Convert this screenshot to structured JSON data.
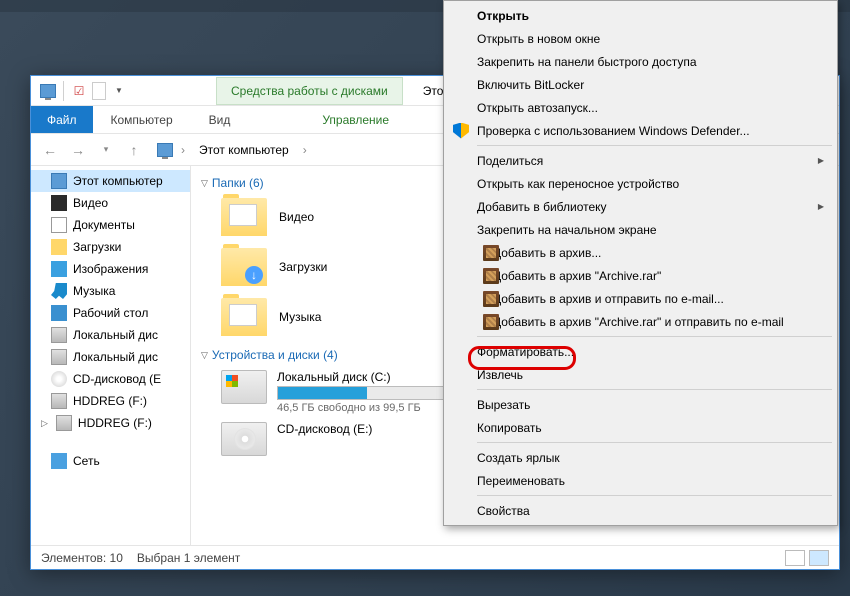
{
  "window": {
    "ribbon_context": "Средства работы с дисками",
    "title": "Этот к",
    "menu": {
      "file": "Файл",
      "computer": "Компьютер",
      "view": "Вид",
      "manage": "Управление"
    },
    "breadcrumb": "Этот компьютер"
  },
  "sidebar": {
    "items": [
      {
        "label": "Этот компьютер",
        "icon": "pc"
      },
      {
        "label": "Видео",
        "icon": "vid"
      },
      {
        "label": "Документы",
        "icon": "doc"
      },
      {
        "label": "Загрузки",
        "icon": "dl"
      },
      {
        "label": "Изображения",
        "icon": "img"
      },
      {
        "label": "Музыка",
        "icon": "mus"
      },
      {
        "label": "Рабочий стол",
        "icon": "desk"
      },
      {
        "label": "Локальный дис",
        "icon": "hdd"
      },
      {
        "label": "Локальный дис",
        "icon": "hdd"
      },
      {
        "label": "CD-дисковод (E",
        "icon": "cd"
      },
      {
        "label": "HDDREG (F:)",
        "icon": "hdd"
      },
      {
        "label": "HDDREG (F:)",
        "icon": "hdd"
      },
      {
        "label": "Сеть",
        "icon": "net"
      }
    ]
  },
  "content": {
    "folders_header": "Папки (6)",
    "folders": [
      {
        "label": "Видео"
      },
      {
        "label": "Загрузки"
      },
      {
        "label": "Музыка"
      }
    ],
    "drives_header": "Устройства и диски (4)",
    "drives": [
      {
        "label": "Локальный диск (C:)",
        "free_text": "46,5 ГБ свободно из 99,5 ГБ",
        "fill_pct": 53,
        "type": "win"
      },
      {
        "label": "CD-дисковод (E:)",
        "free_text": "",
        "fill_pct": 0,
        "type": "cd"
      }
    ]
  },
  "status": {
    "count": "Элементов: 10",
    "selected": "Выбран 1 элемент"
  },
  "contextmenu": {
    "items": [
      {
        "label": "Открыть",
        "bold": true
      },
      {
        "label": "Открыть в новом окне"
      },
      {
        "label": "Закрепить на панели быстрого доступа"
      },
      {
        "label": "Включить BitLocker"
      },
      {
        "label": "Открыть автозапуск..."
      },
      {
        "label": "Проверка с использованием Windows Defender...",
        "icon": "shield"
      },
      {
        "sep": true
      },
      {
        "label": "Поделиться",
        "arrow": true
      },
      {
        "label": "Открыть как переносное устройство"
      },
      {
        "label": "Добавить в библиотеку",
        "arrow": true
      },
      {
        "label": "Закрепить на начальном экране"
      },
      {
        "label": "Добавить в архив...",
        "icon": "rar"
      },
      {
        "label": "Добавить в архив \"Archive.rar\"",
        "icon": "rar"
      },
      {
        "label": "Добавить в архив и отправить по e-mail...",
        "icon": "rar"
      },
      {
        "label": "Добавить в архив \"Archive.rar\" и отправить по e-mail",
        "icon": "rar"
      },
      {
        "sep": true
      },
      {
        "label": "Форматировать..."
      },
      {
        "label": "Извлечь"
      },
      {
        "sep": true
      },
      {
        "label": "Вырезать"
      },
      {
        "label": "Копировать"
      },
      {
        "sep": true
      },
      {
        "label": "Создать ярлык"
      },
      {
        "label": "Переименовать"
      },
      {
        "sep": true
      },
      {
        "label": "Свойства"
      }
    ]
  }
}
